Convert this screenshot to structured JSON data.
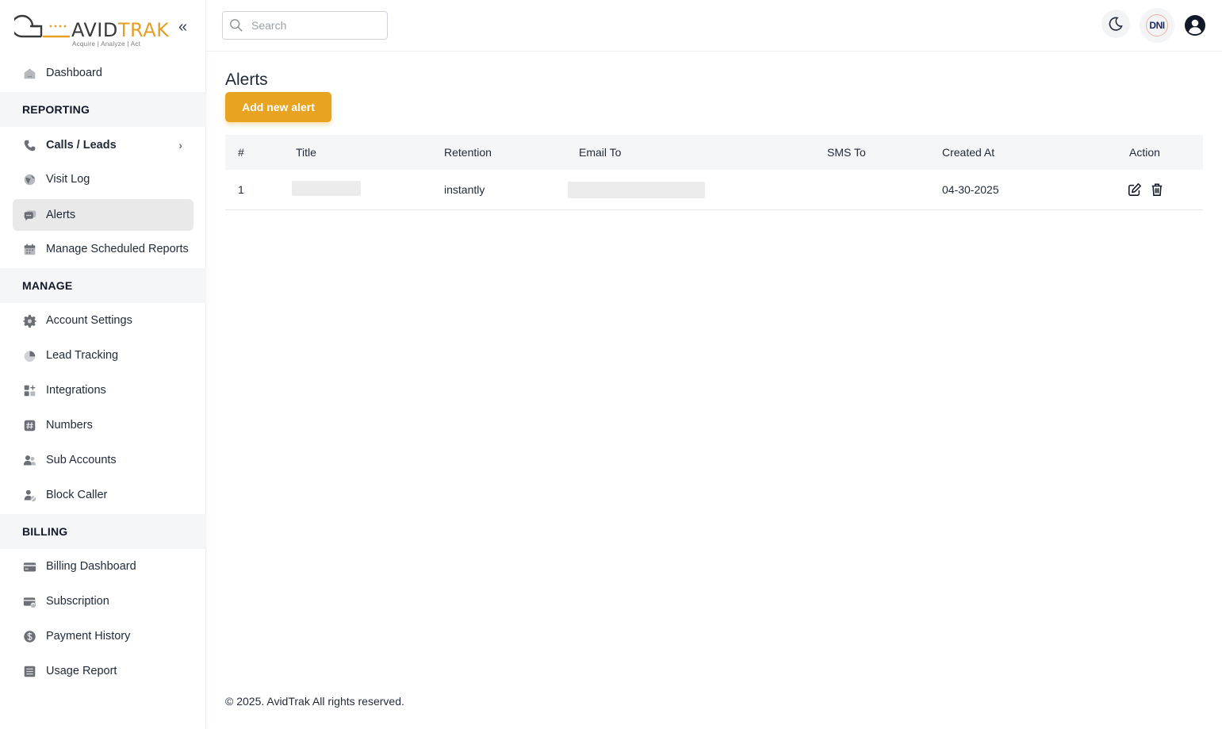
{
  "brand": {
    "logo_mark_prefix": "a",
    "logo_word_dark": "AVID",
    "logo_word_gold": "TRAK",
    "tagline": "Acquire   |   Analyze   |   Act",
    "accent_color": "#e8a321"
  },
  "sidebar": {
    "collapse_icon": "«",
    "dashboard": "Dashboard",
    "sections": {
      "reporting": "REPORTING",
      "manage": "MANAGE",
      "billing": "BILLING"
    },
    "reporting_items": [
      {
        "label": "Calls / Leads",
        "icon": "phone-icon"
      },
      {
        "label": "Visit Log",
        "icon": "globe-icon"
      },
      {
        "label": "Alerts",
        "icon": "chat-bubble-icon"
      },
      {
        "label": "Manage Scheduled Reports",
        "icon": "calendar-icon"
      }
    ],
    "manage_items": [
      {
        "label": "Account Settings",
        "icon": "gear-icon"
      },
      {
        "label": "Lead Tracking",
        "icon": "pie-chart-icon"
      },
      {
        "label": "Integrations",
        "icon": "grid-plus-icon"
      },
      {
        "label": "Numbers",
        "icon": "hash-icon"
      },
      {
        "label": "Sub Accounts",
        "icon": "users-icon"
      },
      {
        "label": "Block Caller",
        "icon": "user-block-icon"
      }
    ],
    "billing_items": [
      {
        "label": "Billing Dashboard",
        "icon": "credit-card-icon"
      },
      {
        "label": "Subscription",
        "icon": "card-sync-icon"
      },
      {
        "label": "Payment History",
        "icon": "dollar-circle-icon"
      },
      {
        "label": "Usage Report",
        "icon": "list-doc-icon"
      }
    ],
    "active_item": "Alerts"
  },
  "header": {
    "search_placeholder": "Search",
    "dni_label": "DNI"
  },
  "main": {
    "title": "Alerts",
    "add_button": "Add new alert",
    "table": {
      "columns": [
        "#",
        "Title",
        "Retention",
        "Email To",
        "SMS To",
        "Created At",
        "Action"
      ],
      "rows": [
        {
          "index": "1",
          "title": "",
          "retention": "instantly",
          "email_to": "",
          "sms_to": "",
          "created_at": "04-30-2025"
        }
      ]
    }
  },
  "footer": {
    "copyright": "© 2025. AvidTrak All rights reserved."
  }
}
